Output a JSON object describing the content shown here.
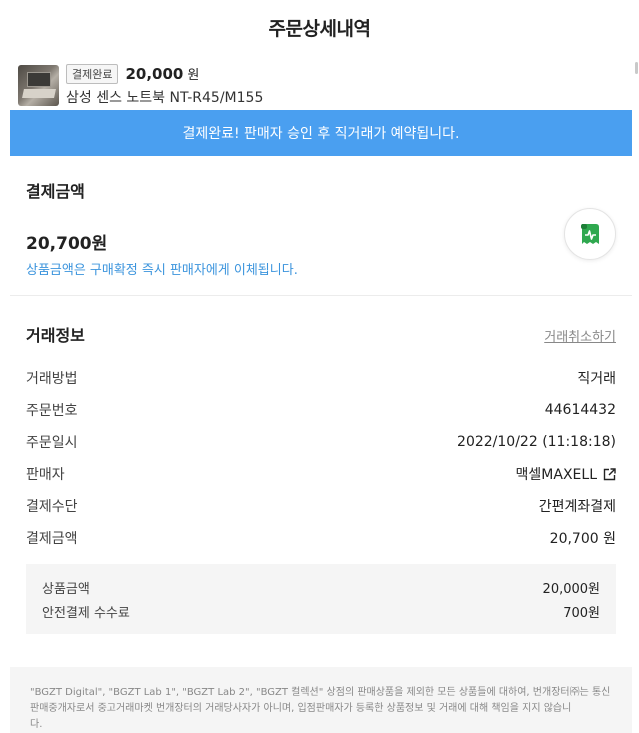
{
  "header": {
    "title": "주문상세내역"
  },
  "product": {
    "status": "결제완료",
    "price": "20,000",
    "price_unit": "원",
    "name": "삼성 센스 노트북 NT-R45/M155"
  },
  "banner": {
    "text": "결제완료! 판매자 승인 후 직거래가 예약됩니다."
  },
  "payment": {
    "title": "결제금액",
    "amount": "20,700원",
    "note": "상품금액은 구매확정 즉시 판매자에게 이체됩니다."
  },
  "deal": {
    "title": "거래정보",
    "cancel_label": "거래취소하기",
    "rows": [
      {
        "label": "거래방법",
        "value": "직거래"
      },
      {
        "label": "주문번호",
        "value": "44614432"
      },
      {
        "label": "주문일시",
        "value": "2022/10/22 (11:18:18)"
      },
      {
        "label": "판매자",
        "value": "맥셀MAXELL"
      },
      {
        "label": "결제수단",
        "value": "간편계좌결제"
      },
      {
        "label": "결제금액",
        "value": "20,700 원"
      }
    ],
    "fees": [
      {
        "label": "상품금액",
        "value": "20,000원"
      },
      {
        "label": "안전결제 수수료",
        "value": "700원"
      }
    ]
  },
  "disclaimer": {
    "line1": "\"BGZT Digital\", \"BGZT Lab 1\", \"BGZT Lab 2\", \"BGZT 컬렉션\" 상점의 판매상품을 제외한 모든 상품들에 대하여, 번개장터㈜는 통신",
    "line2": "판매중개자로서 중고거래마켓 번개장터의 거래당사자가 아니며, 입점판매자가 등록한 상품정보 및 거래에 대해 책임을 지지 않습니",
    "line3": "다."
  },
  "colors": {
    "banner": "#4a9ff0",
    "note": "#3b94dd",
    "receipt_icon": "#2fa84f"
  },
  "icons": {
    "receipt": "receipt-icon",
    "external": "external-link-icon"
  }
}
